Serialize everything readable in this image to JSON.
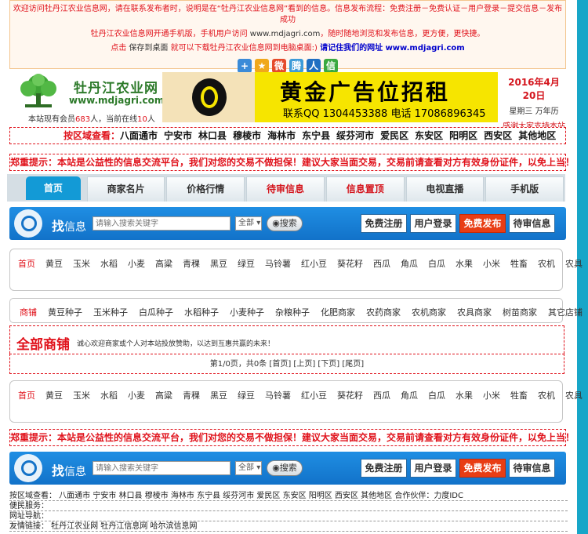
{
  "notice": {
    "line1": "欢迎访问牡丹江农业信息网，请在联系发布者时，说明是在“牡丹江农业信息网”看到的信息。信息发布流程：免费注册－免费认证－用户登录－提交信息－发布成功",
    "line2_prefix": "牡丹江农业信息网开通手机版，手机用户访问 ",
    "line2_url": "www.mdjagri.com",
    "line2_suffix": "，随时随地浏览和发布信息，更方便，更快捷。",
    "line3_click": "点击",
    "line3_save": " 保存到桌面 ",
    "line3_desc": "就可以下载牡丹江农业信息网到电脑桌面:)",
    "line3_link_prefix": "请记住我们的网址 ",
    "line3_link_url": "www.mdjagri.com"
  },
  "share_icons": [
    {
      "name": "plus-share-icon",
      "glyph": "+",
      "color": "#3b8bd8"
    },
    {
      "name": "qzone-share-icon",
      "glyph": "★",
      "color": "#f0a81b"
    },
    {
      "name": "weibo-share-icon",
      "glyph": "微",
      "color": "#e54b2b"
    },
    {
      "name": "tencent-weibo-share-icon",
      "glyph": "腾",
      "color": "#3d9bd8"
    },
    {
      "name": "renren-share-icon",
      "glyph": "人",
      "color": "#1f6fc2"
    },
    {
      "name": "wechat-share-icon",
      "glyph": "信",
      "color": "#3aa93f"
    }
  ],
  "logo": {
    "title": "牡丹江农业网",
    "url": "www.mdjagri.com",
    "members_prefix": "本站现有会员",
    "members_count": "683",
    "members_mid": "人，当前在线",
    "online_count": "10",
    "members_suffix": "人"
  },
  "banner": {
    "headline": "黄金广告位招租",
    "contact": "联系QQ 1304453388 电话 17086896345"
  },
  "date": {
    "date": "2016年4月20日",
    "weekday": "星期三 万年历",
    "thanks": "感谢大家支持本站"
  },
  "region": {
    "label": "按区域查看：",
    "items": [
      "八面通市",
      "宁安市",
      "林口县",
      "穆棱市",
      "海林市",
      "东宁县",
      "绥芬河市",
      "爱民区",
      "东安区",
      "阳明区",
      "西安区",
      "其他地区"
    ]
  },
  "warning": {
    "label": "郑重提示：",
    "text": "本站是公益性的信息交流平台，我们对您的交易不做担保！建议大家当面交易，交易前请查看对方有效身份证件，以免上当！"
  },
  "nav": {
    "tabs": [
      {
        "label": "首页",
        "style": "active"
      },
      {
        "label": "商家名片",
        "style": ""
      },
      {
        "label": "价格行情",
        "style": ""
      },
      {
        "label": "待审信息",
        "style": "red"
      },
      {
        "label": "信息置顶",
        "style": "red"
      },
      {
        "label": "电视直播",
        "style": ""
      },
      {
        "label": "手机版",
        "style": ""
      }
    ]
  },
  "search": {
    "title_main": "找",
    "title_sub": "信息",
    "placeholder": "请输入搜索关键字",
    "scope": "全部",
    "button": "搜索",
    "register": "免费注册",
    "login": "用户登录",
    "publish": "免费发布",
    "pending": "待审信息"
  },
  "categories": [
    "首页",
    "黄豆",
    "玉米",
    "水稻",
    "小麦",
    "高粱",
    "青稞",
    "黑豆",
    "绿豆",
    "马铃薯",
    "红小豆",
    "葵花籽",
    "西瓜",
    "角瓜",
    "白瓜",
    "水果",
    "小米",
    "牲畜",
    "农机",
    "农具"
  ],
  "shop_categories": [
    "商铺",
    "黄豆种子",
    "玉米种子",
    "白瓜种子",
    "水稻种子",
    "小麦种子",
    "杂粮种子",
    "化肥商家",
    "农药商家",
    "农机商家",
    "农具商家",
    "树苗商家",
    "其它店铺"
  ],
  "all_shops": {
    "title": "全部商铺",
    "subtitle": "诚心欢迎商家或个人对本站投放赞助，以达到互惠共赢的未来！"
  },
  "pager": {
    "text": "第1/0页，共0条 [首页] [上页] [下页] [尾页]"
  },
  "footer": {
    "region_row": "按区域查看： 八面通市  宁安市  林口县  穆棱市  海林市  东宁县  绥芬河市  爱民区  东安区  阳明区  西安区  其他地区     合作伙伴：力度IDC",
    "service_row": "便民服务：",
    "nav_row": "网址导航：",
    "links_row": "友情链接： 牡丹江农业网  牡丹江信息网  哈尔滨信息网"
  }
}
